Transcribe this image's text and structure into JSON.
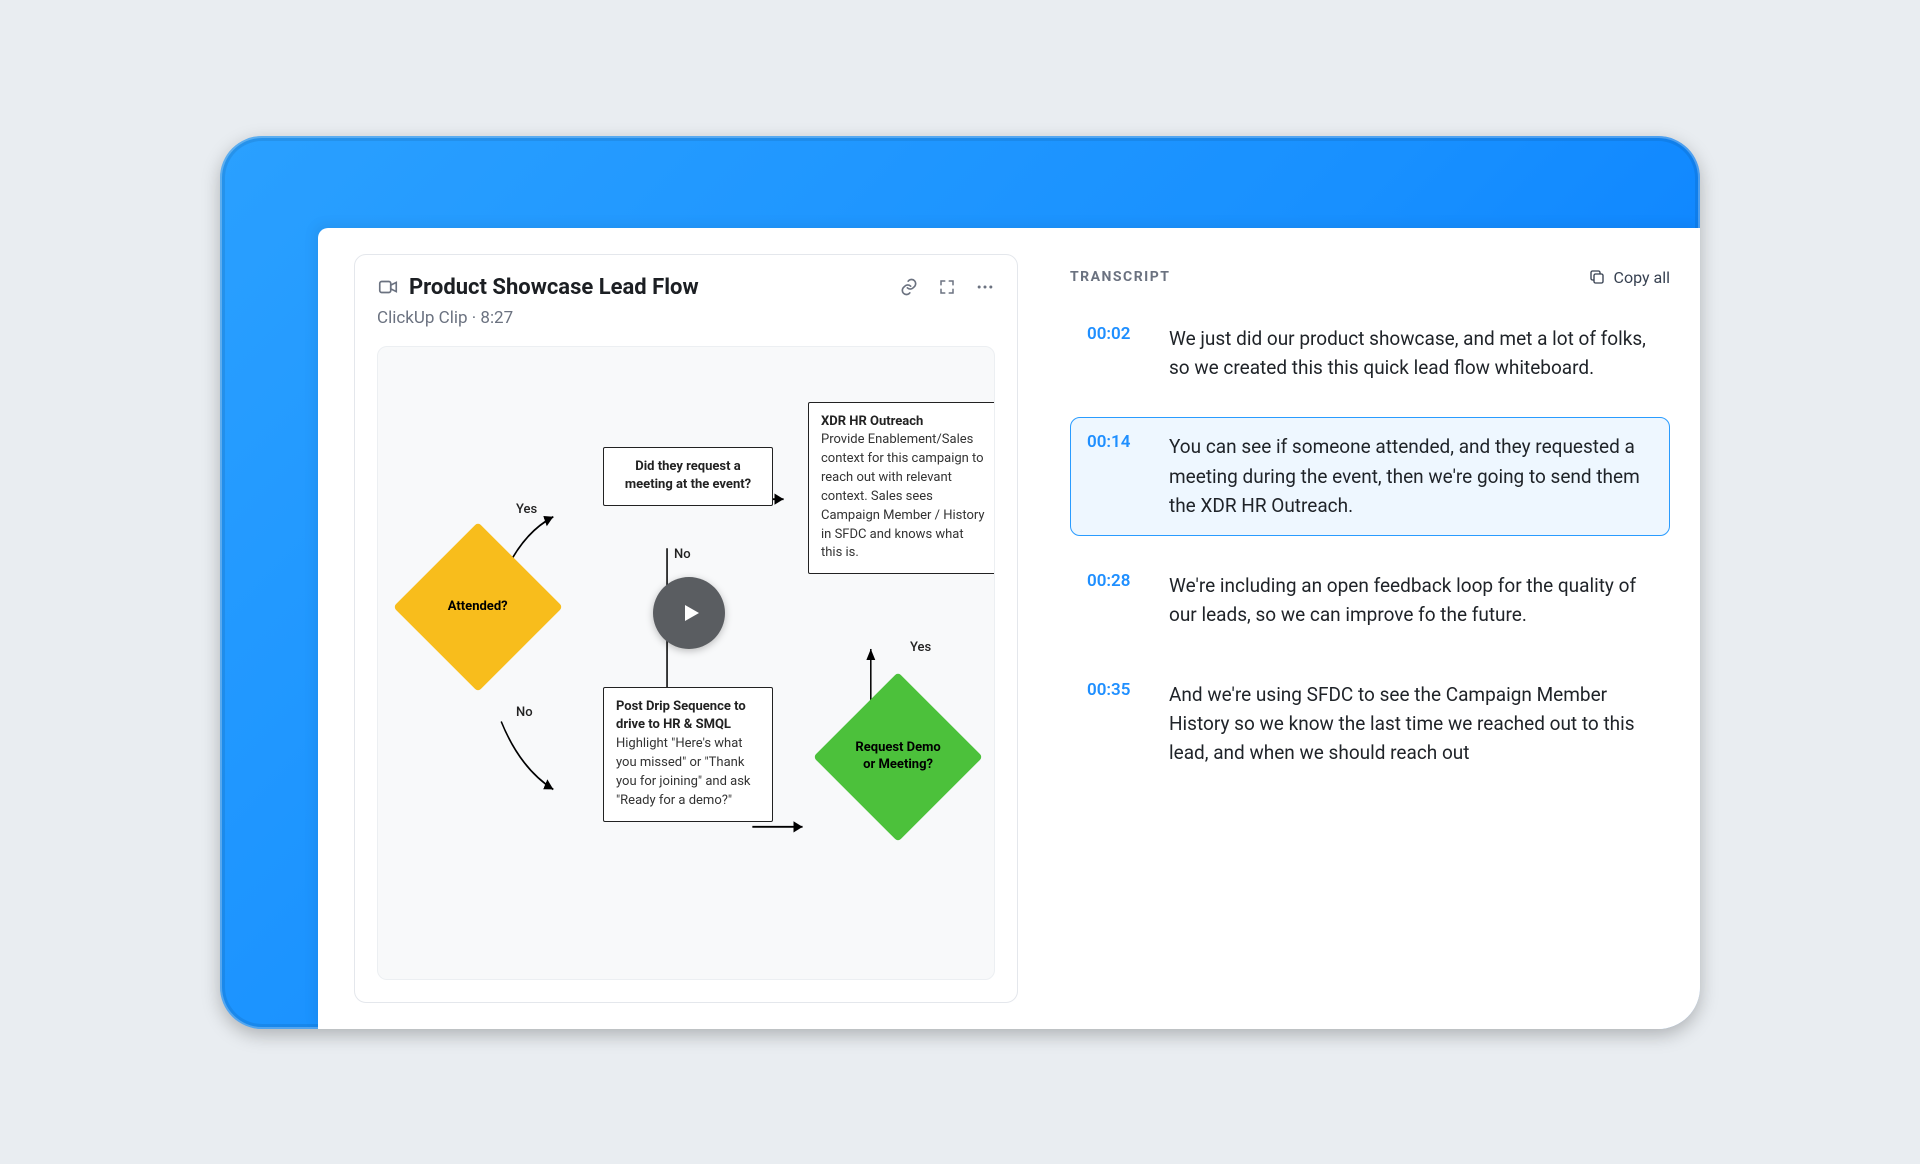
{
  "clip": {
    "title": "Product Showcase Lead Flow",
    "source": "ClickUp Clip",
    "duration": "8:27",
    "meta_sep": " · "
  },
  "flow": {
    "attended_label": "Attended?",
    "yes": "Yes",
    "no": "No",
    "request_meeting": "Did they request a meeting at the event?",
    "xdr_title": "XDR HR Outreach",
    "xdr_body": "Provide Enablement/Sales context for this campaign to reach out with relevant context. Sales sees Campaign Member / History in SFDC and knows what this is.",
    "drip_title": "Post Drip Sequence to drive to HR & SMQL",
    "drip_body": "Highlight \"Here's what you missed\" or \"Thank you for joining\" and ask \"Ready for a demo?\"",
    "demo_label": "Request Demo or Meeting?"
  },
  "transcript": {
    "heading": "TRANSCRIPT",
    "copy_label": "Copy all",
    "active_index": 1,
    "entries": [
      {
        "ts": "00:02",
        "text": "We just did our product showcase, and met a lot of folks, so we created this this quick lead flow whiteboard."
      },
      {
        "ts": "00:14",
        "text": "You can see if someone attended, and they requested a meeting during the event, then we're going to send them the XDR HR Outreach."
      },
      {
        "ts": "00:28",
        "text": "We're including an open feedback loop for the quality of our leads, so we can improve fo the future."
      },
      {
        "ts": "00:35",
        "text": "And we're using SFDC to see the Campaign Member History so we know the last time we reached out to this lead, and when we should reach out"
      }
    ]
  }
}
